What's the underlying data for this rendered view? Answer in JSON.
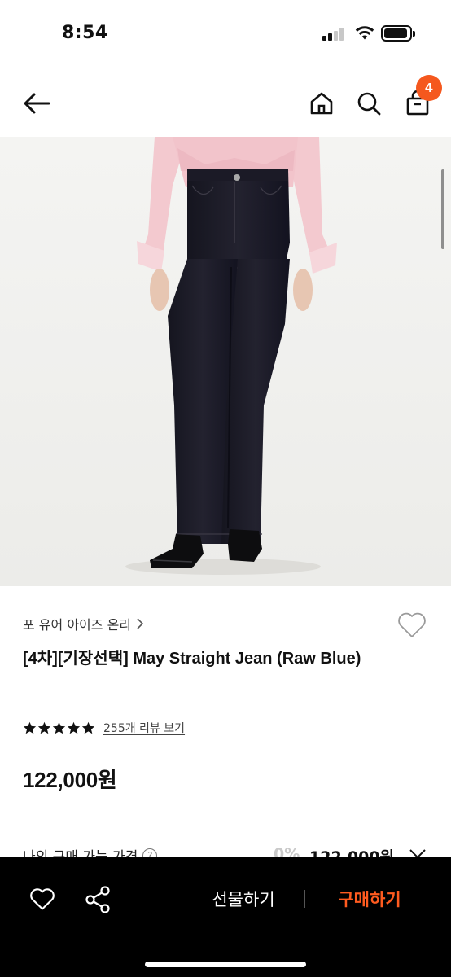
{
  "status_bar": {
    "time": "8:54"
  },
  "header": {
    "back_icon": "arrow-left-icon",
    "home_icon": "home-icon",
    "search_icon": "search-icon",
    "cart_icon": "shopping-bag-icon",
    "cart_count": "4"
  },
  "colors": {
    "accent": "#f5581e",
    "buy_text": "#ff5b1f",
    "bottom_bar": "#000000"
  },
  "product": {
    "brand": "포 유어 아이즈 온리",
    "title": "[4차][기장선택] May Straight Jean (Raw Blue)",
    "rating_stars": 5,
    "review_link": "255개 리뷰 보기",
    "price": "122,000원"
  },
  "purchase_info": {
    "label": "나의 구매 가능 가격",
    "help_symbol": "?",
    "discount": "0%",
    "price": "122,000원"
  },
  "bottom_bar": {
    "wishlist_icon": "heart-icon",
    "share_icon": "share-icon",
    "gift_label": "선물하기",
    "buy_label": "구매하기"
  }
}
